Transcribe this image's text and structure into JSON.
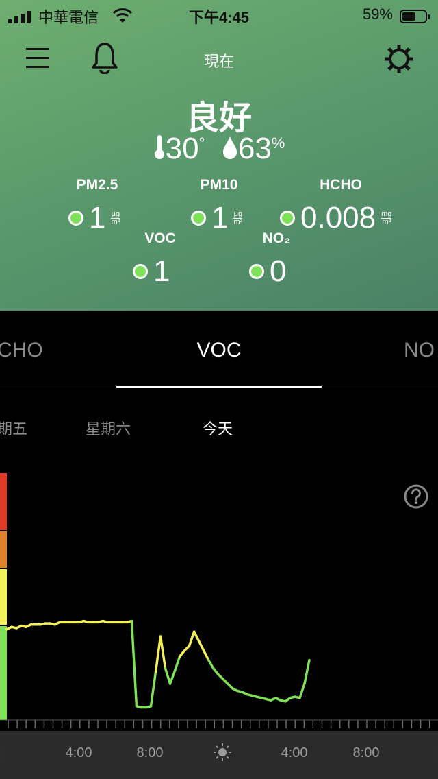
{
  "status_bar": {
    "carrier": "中華電信",
    "time": "下午4:45",
    "battery": "59%",
    "battery_level": 0.59
  },
  "nav": {
    "title": "現在"
  },
  "summary": {
    "quality": "良好",
    "temperature": "30",
    "temperature_unit": "°",
    "humidity": "63",
    "humidity_unit": "%"
  },
  "pollutants": [
    {
      "label": "PM2.5",
      "value": "1",
      "unit_top": "μg",
      "unit_bottom": "m³"
    },
    {
      "label": "PM10",
      "value": "1",
      "unit_top": "μg",
      "unit_bottom": "m³"
    },
    {
      "label": "HCHO",
      "value": "0.008",
      "unit_top": "mg",
      "unit_bottom": "m³"
    },
    {
      "label": "VOC",
      "value": "1"
    },
    {
      "label": "NO₂",
      "value": "0"
    }
  ],
  "tabs": {
    "left": "CHO",
    "selected": "VOC",
    "right": "NO"
  },
  "days": {
    "prev2": "期五",
    "prev1": "星期六",
    "today": "今天"
  },
  "colors": {
    "accent_green": "#7fe05a",
    "line_yellow": "#f4f05a",
    "scale_red": "#e03a24",
    "scale_orange": "#e0802a",
    "scale_yellow": "#f4f05a",
    "scale_green": "#7fe05a"
  },
  "chart_data": {
    "type": "line",
    "x_ticks": [
      "4:00",
      "8:00",
      "4:00",
      "8:00"
    ],
    "x_icons": [
      "moon-icon",
      "sun-icon",
      "moon-icon"
    ],
    "series": [
      {
        "values": [
          0.68,
          0.7,
          0.69,
          0.71,
          0.7,
          0.72,
          0.72,
          0.72,
          0.73,
          0.73,
          0.72,
          0.74,
          0.74,
          0.74,
          0.74,
          0.74,
          0.75,
          0.74,
          0.74,
          0.74,
          0.75,
          0.74,
          0.74,
          0.74,
          0.74,
          0.74,
          0.75,
          0.03,
          0.02,
          0.02,
          0.03,
          0.32,
          0.62,
          0.35,
          0.22,
          0.33,
          0.45,
          0.5,
          0.54,
          0.66,
          0.58,
          0.5,
          0.42,
          0.35,
          0.3,
          0.26,
          0.22,
          0.18,
          0.16,
          0.15,
          0.13,
          0.12,
          0.11,
          0.1,
          0.09,
          0.08,
          0.1,
          0.08,
          0.07,
          0.1,
          0.11,
          0.1,
          0.22,
          0.42
        ]
      }
    ]
  }
}
